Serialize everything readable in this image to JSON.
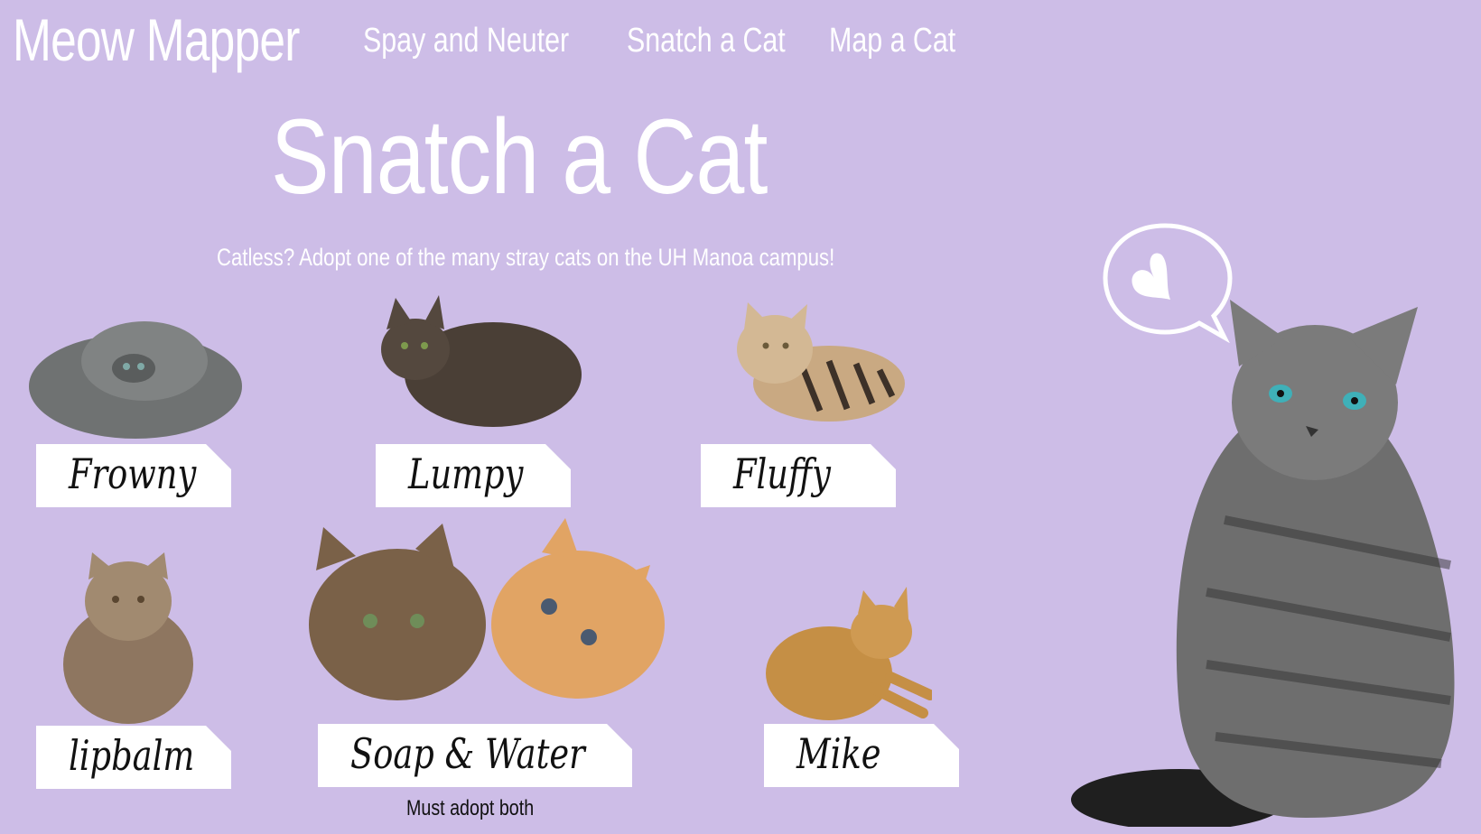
{
  "brand": "Meow Mapper",
  "nav": {
    "spay": "Spay and Neuter",
    "snatch": "Snatch a Cat",
    "map": "Map a Cat"
  },
  "page": {
    "title": "Snatch a Cat",
    "subtitle": "Catless? Adopt one of the many stray cats on the UH Manoa campus!"
  },
  "cats": [
    {
      "name": "Frowny"
    },
    {
      "name": "Lumpy"
    },
    {
      "name": "Fluffy"
    },
    {
      "name": "lipbalm"
    },
    {
      "name": "Soap & Water",
      "note": "Must adopt both"
    },
    {
      "name": "Mike"
    }
  ],
  "colors": {
    "background": "#cdbde7",
    "text": "#ffffff",
    "card": "#ffffff"
  }
}
